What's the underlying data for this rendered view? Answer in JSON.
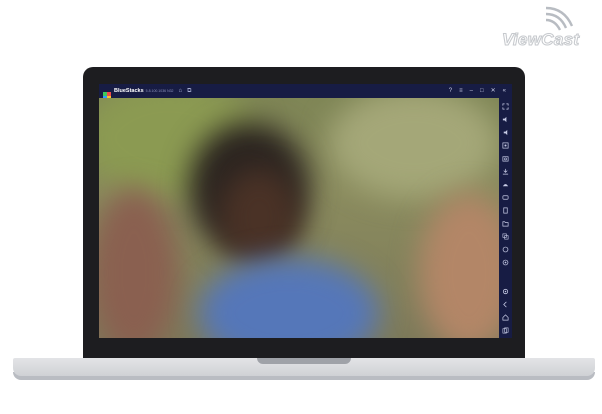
{
  "watermark": {
    "text": "ViewCast",
    "icon": "signal-arcs-icon",
    "color": "#c6c9cd"
  },
  "window": {
    "app_title": "BlueStacks",
    "version": "5.8.100.1036 N32",
    "title_icons": [
      "home-icon",
      "multi-instance-icon"
    ],
    "controls": [
      "help-icon",
      "menu-icon",
      "minimize-icon",
      "restore-icon",
      "close-icon",
      "collapse-sidebar-icon"
    ],
    "accent": "#171c44"
  },
  "sidebar": {
    "items": [
      "fullscreen-icon",
      "volume-up-icon",
      "volume-down-icon",
      "screen-record-icon",
      "screenshot-icon",
      "install-apk-icon",
      "macro-icon",
      "game-controls-icon",
      "shake-icon",
      "folder-icon",
      "multi-instance-manager-icon",
      "eco-mode-icon",
      "location-icon",
      "settings-icon",
      "back-icon",
      "home-icon",
      "recent-apps-icon"
    ]
  },
  "content": {
    "description_visible": "blurred video frame"
  }
}
